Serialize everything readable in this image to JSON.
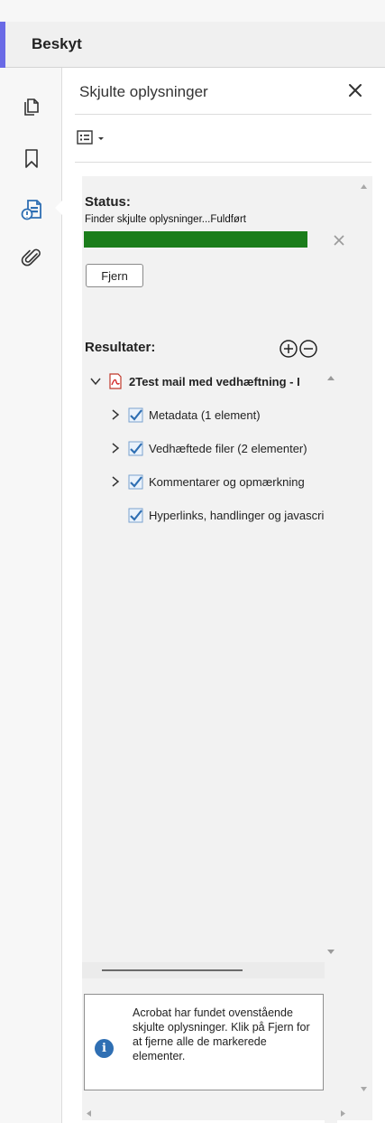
{
  "header": {
    "title": "Beskyt"
  },
  "rail": {
    "items": [
      {
        "name": "pages",
        "icon": "pages-icon"
      },
      {
        "name": "bookmarks",
        "icon": "bookmark-icon"
      },
      {
        "name": "redact",
        "icon": "redact-document-icon",
        "active": true
      },
      {
        "name": "attachments",
        "icon": "paperclip-icon"
      }
    ]
  },
  "panel": {
    "title": "Skjulte oplysninger",
    "close_icon": "close-icon",
    "options_icon": "options-menu-icon"
  },
  "status": {
    "label": "Status:",
    "text": "Finder skjulte oplysninger...Fuldført",
    "progress": 1.0,
    "progress_color": "#1b7d1b",
    "remove_button": "Fjern"
  },
  "results": {
    "label": "Resultater:",
    "root": {
      "label": "2Test mail med vedhæftning - I",
      "icon": "pdf-icon",
      "expanded": true
    },
    "items": [
      {
        "label": "Metadata (1 element)",
        "checked": true,
        "expandable": true
      },
      {
        "label": "Vedhæftede filer (2 elementer)",
        "checked": true,
        "expandable": true
      },
      {
        "label": "Kommentarer og opmærkning",
        "checked": true,
        "expandable": true
      },
      {
        "label": "Hyperlinks, handlinger og javascript",
        "checked": true,
        "expandable": false
      }
    ]
  },
  "info": {
    "icon": "info-icon",
    "text": "Acrobat har fundet ovenstående skjulte oplysninger. Klik på Fjern for at fjerne alle de markerede elementer."
  },
  "colors": {
    "accent": "#6a6ae6",
    "info": "#2f6fb3",
    "check": "#2f6fb3"
  }
}
